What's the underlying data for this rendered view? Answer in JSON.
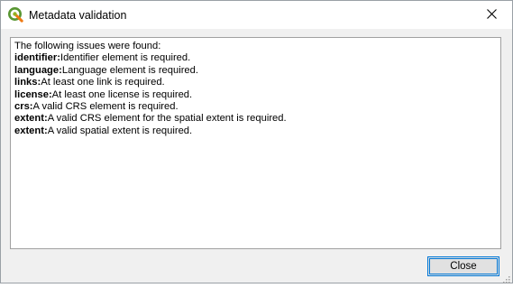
{
  "window": {
    "title": "Metadata validation",
    "app_icon": "qgis-logo-icon",
    "close_icon": "close-icon"
  },
  "message": {
    "intro": "The following issues were found:",
    "issues": [
      {
        "key": "identifier:",
        "text": "Identifier element is required."
      },
      {
        "key": "language:",
        "text": "Language element is required."
      },
      {
        "key": "links:",
        "text": "At least one link is required."
      },
      {
        "key": "license:",
        "text": "At least one license is required."
      },
      {
        "key": "crs:",
        "text": "A valid CRS element is required."
      },
      {
        "key": "extent:",
        "text": "A valid CRS element for the spatial extent is required."
      },
      {
        "key": "extent:",
        "text": "A valid spatial extent is required."
      }
    ]
  },
  "buttons": {
    "close_label": "Close"
  },
  "colors": {
    "accent": "#0078d7",
    "qgis_green": "#589632",
    "qgis_yellow": "#ee7913"
  }
}
